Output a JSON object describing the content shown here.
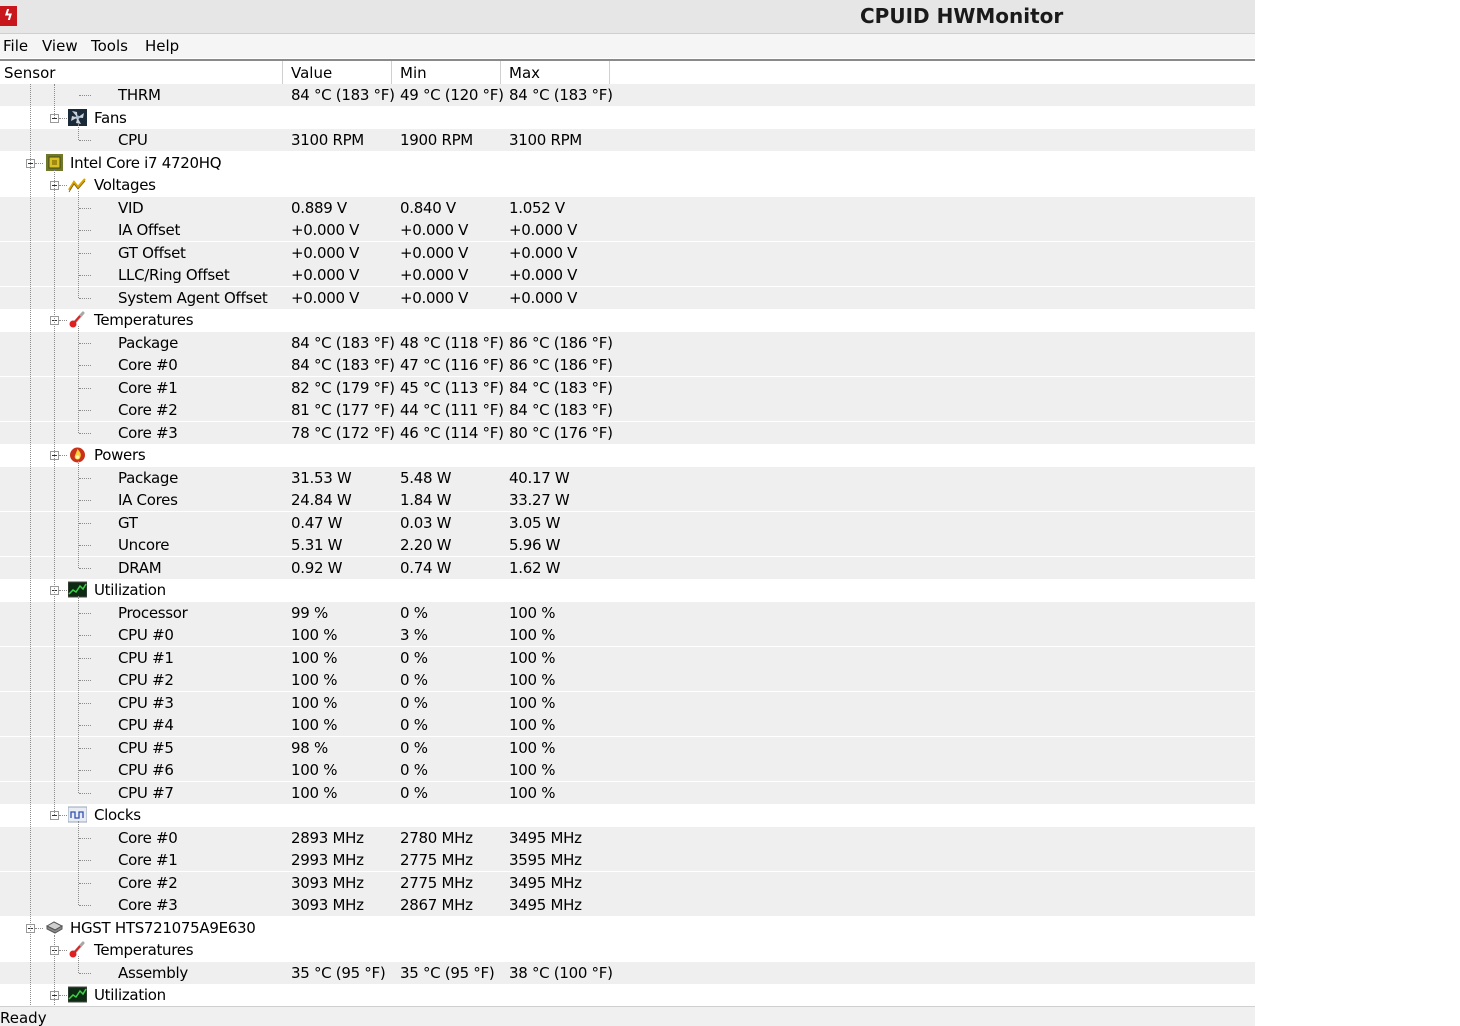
{
  "window": {
    "title": "CPUID HWMonitor",
    "icon": "hwmonitor-app-icon"
  },
  "menu": [
    "File",
    "View",
    "Tools",
    "Help"
  ],
  "columns": [
    "Sensor",
    "Value",
    "Min",
    "Max"
  ],
  "status": "Ready",
  "rows": [
    {
      "d": 3,
      "label": "THRM",
      "value": "84 °C  (183 °F)",
      "min": "49 °C  (120 °F)",
      "max": "84 °C  (183 °F)"
    },
    {
      "d": 2,
      "label": "Fans",
      "icon": "fan-icon",
      "group": true
    },
    {
      "d": 3,
      "label": "CPU",
      "value": "3100 RPM",
      "min": "1900 RPM",
      "max": "3100 RPM"
    },
    {
      "d": 1,
      "label": "Intel Core i7 4720HQ",
      "icon": "cpu-chip-icon",
      "group": true
    },
    {
      "d": 2,
      "label": "Voltages",
      "icon": "voltage-icon",
      "group": true
    },
    {
      "d": 3,
      "label": "VID",
      "value": "0.889 V",
      "min": "0.840 V",
      "max": "1.052 V"
    },
    {
      "d": 3,
      "label": "IA Offset",
      "value": "+0.000 V",
      "min": "+0.000 V",
      "max": "+0.000 V"
    },
    {
      "d": 3,
      "label": "GT Offset",
      "value": "+0.000 V",
      "min": "+0.000 V",
      "max": "+0.000 V"
    },
    {
      "d": 3,
      "label": "LLC/Ring Offset",
      "value": "+0.000 V",
      "min": "+0.000 V",
      "max": "+0.000 V"
    },
    {
      "d": 3,
      "label": "System Agent Offset",
      "value": "+0.000 V",
      "min": "+0.000 V",
      "max": "+0.000 V"
    },
    {
      "d": 2,
      "label": "Temperatures",
      "icon": "thermometer-icon",
      "group": true
    },
    {
      "d": 3,
      "label": "Package",
      "value": "84 °C  (183 °F)",
      "min": "48 °C  (118 °F)",
      "max": "86 °C  (186 °F)"
    },
    {
      "d": 3,
      "label": "Core #0",
      "value": "84 °C  (183 °F)",
      "min": "47 °C  (116 °F)",
      "max": "86 °C  (186 °F)"
    },
    {
      "d": 3,
      "label": "Core #1",
      "value": "82 °C  (179 °F)",
      "min": "45 °C  (113 °F)",
      "max": "84 °C  (183 °F)"
    },
    {
      "d": 3,
      "label": "Core #2",
      "value": "81 °C  (177 °F)",
      "min": "44 °C  (111 °F)",
      "max": "84 °C  (183 °F)"
    },
    {
      "d": 3,
      "label": "Core #3",
      "value": "78 °C  (172 °F)",
      "min": "46 °C  (114 °F)",
      "max": "80 °C  (176 °F)"
    },
    {
      "d": 2,
      "label": "Powers",
      "icon": "power-flame-icon",
      "group": true
    },
    {
      "d": 3,
      "label": "Package",
      "value": "31.53 W",
      "min": "5.48 W",
      "max": "40.17 W"
    },
    {
      "d": 3,
      "label": "IA Cores",
      "value": "24.84 W",
      "min": "1.84 W",
      "max": "33.27 W"
    },
    {
      "d": 3,
      "label": "GT",
      "value": "0.47 W",
      "min": "0.03 W",
      "max": "3.05 W"
    },
    {
      "d": 3,
      "label": "Uncore",
      "value": "5.31 W",
      "min": "2.20 W",
      "max": "5.96 W"
    },
    {
      "d": 3,
      "label": "DRAM",
      "value": "0.92 W",
      "min": "0.74 W",
      "max": "1.62 W"
    },
    {
      "d": 2,
      "label": "Utilization",
      "icon": "utilization-graph-icon",
      "group": true
    },
    {
      "d": 3,
      "label": "Processor",
      "value": "99 %",
      "min": "0 %",
      "max": "100 %"
    },
    {
      "d": 3,
      "label": "CPU #0",
      "value": "100 %",
      "min": "3 %",
      "max": "100 %"
    },
    {
      "d": 3,
      "label": "CPU #1",
      "value": "100 %",
      "min": "0 %",
      "max": "100 %"
    },
    {
      "d": 3,
      "label": "CPU #2",
      "value": "100 %",
      "min": "0 %",
      "max": "100 %"
    },
    {
      "d": 3,
      "label": "CPU #3",
      "value": "100 %",
      "min": "0 %",
      "max": "100 %"
    },
    {
      "d": 3,
      "label": "CPU #4",
      "value": "100 %",
      "min": "0 %",
      "max": "100 %"
    },
    {
      "d": 3,
      "label": "CPU #5",
      "value": "98 %",
      "min": "0 %",
      "max": "100 %"
    },
    {
      "d": 3,
      "label": "CPU #6",
      "value": "100 %",
      "min": "0 %",
      "max": "100 %"
    },
    {
      "d": 3,
      "label": "CPU #7",
      "value": "100 %",
      "min": "0 %",
      "max": "100 %"
    },
    {
      "d": 2,
      "label": "Clocks",
      "icon": "clock-wave-icon",
      "group": true
    },
    {
      "d": 3,
      "label": "Core #0",
      "value": "2893 MHz",
      "min": "2780 MHz",
      "max": "3495 MHz"
    },
    {
      "d": 3,
      "label": "Core #1",
      "value": "2993 MHz",
      "min": "2775 MHz",
      "max": "3595 MHz"
    },
    {
      "d": 3,
      "label": "Core #2",
      "value": "3093 MHz",
      "min": "2775 MHz",
      "max": "3495 MHz"
    },
    {
      "d": 3,
      "label": "Core #3",
      "value": "3093 MHz",
      "min": "2867 MHz",
      "max": "3495 MHz"
    },
    {
      "d": 1,
      "label": "HGST HTS721075A9E630",
      "icon": "hard-drive-icon",
      "group": true
    },
    {
      "d": 2,
      "label": "Temperatures",
      "icon": "thermometer-icon",
      "group": true
    },
    {
      "d": 3,
      "label": "Assembly",
      "value": "35 °C  (95 °F)",
      "min": "35 °C  (95 °F)",
      "max": "38 °C  (100 °F)"
    },
    {
      "d": 2,
      "label": "Utilization",
      "icon": "utilization-graph-icon",
      "group": true
    }
  ]
}
